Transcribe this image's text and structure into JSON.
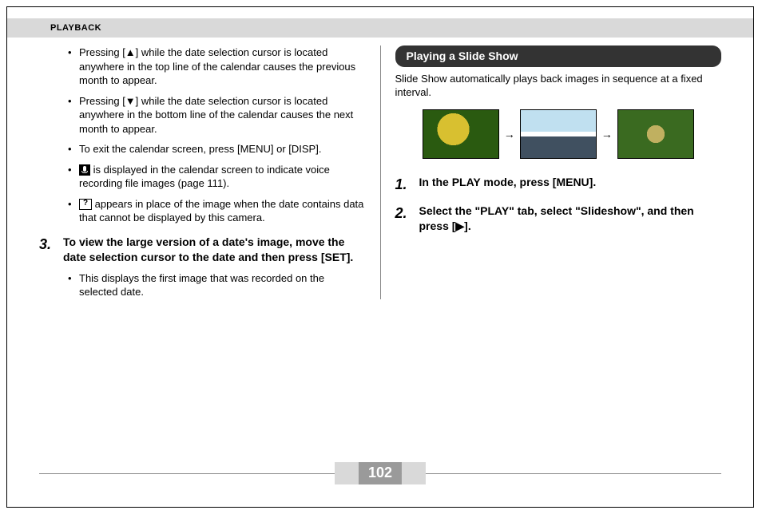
{
  "header": {
    "section": "PLAYBACK"
  },
  "left": {
    "bullets": [
      "Pressing [▲] while the date selection cursor is located anywhere in the top line of the calendar causes the previous month to appear.",
      "Pressing [▼] while the date selection cursor is located anywhere in the bottom line of the calendar causes the next month to appear.",
      "To exit the calendar screen, press [MENU] or [DISP].",
      " is displayed in the calendar screen to indicate voice recording file images (page 111).",
      " appears in place of the image when the date contains data that cannot be displayed by this camera."
    ],
    "bullet_icons": {
      "3": "mic",
      "4": "question"
    },
    "step3": {
      "num": "3.",
      "text": "To view the large version of a date's image, move the date selection cursor to the date and then press [SET].",
      "sub": "This displays the first image that was recorded on the selected date."
    }
  },
  "right": {
    "heading": "Playing a Slide Show",
    "intro": "Slide Show automatically plays back images in sequence at a fixed interval.",
    "arrow": "→",
    "steps": [
      {
        "num": "1.",
        "text": "In the PLAY mode, press [MENU]."
      },
      {
        "num": "2.",
        "text": "Select the \"PLAY\" tab, select \"Slideshow\", and then press [▶]."
      }
    ]
  },
  "page_number": "102"
}
